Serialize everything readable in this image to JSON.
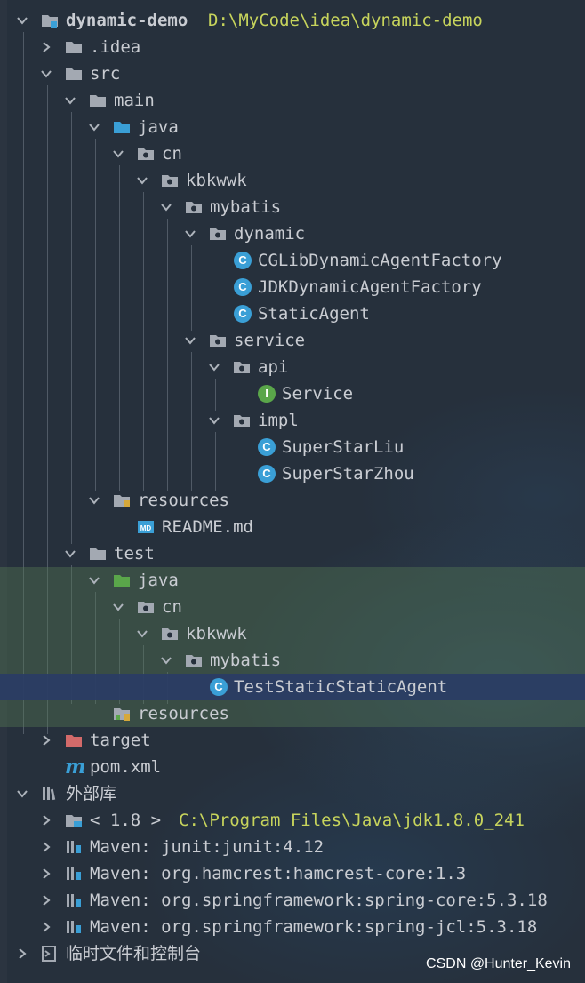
{
  "project": {
    "name": "dynamic-demo",
    "path": "D:\\MyCode\\idea\\dynamic-demo"
  },
  "nodes": {
    "idea": ".idea",
    "src": "src",
    "main": "main",
    "java_main": "java",
    "cn_main": "cn",
    "kbkwwk_main": "kbkwwk",
    "mybatis_main": "mybatis",
    "dynamic": "dynamic",
    "cglib": "CGLibDynamicAgentFactory",
    "jdk": "JDKDynamicAgentFactory",
    "static_agent": "StaticAgent",
    "service": "service",
    "api": "api",
    "service_intf": "Service",
    "impl": "impl",
    "liu": "SuperStarLiu",
    "zhou": "SuperStarZhou",
    "resources_main": "resources",
    "readme": "README.md",
    "test": "test",
    "java_test": "java",
    "cn_test": "cn",
    "kbkwwk_test": "kbkwwk",
    "mybatis_test": "mybatis",
    "test_class": "TestStaticStaticAgent",
    "resources_test": "resources",
    "target": "target",
    "pom": "pom.xml"
  },
  "external": {
    "label": "外部库",
    "jdk_label": "< 1.8 >",
    "jdk_path": "C:\\Program Files\\Java\\jdk1.8.0_241",
    "libs": [
      "Maven: junit:junit:4.12",
      "Maven: org.hamcrest:hamcrest-core:1.3",
      "Maven: org.springframework:spring-core:5.3.18",
      "Maven: org.springframework:spring-jcl:5.3.18"
    ]
  },
  "scratches": "临时文件和控制台",
  "watermark": "CSDN @Hunter_Kevin",
  "colors": {
    "background": "#26303c",
    "folder": "#a3a9b2",
    "source_folder": "#3a9fd6",
    "test_folder": "#5aa64a",
    "excluded_folder": "#d36a6a",
    "path_text": "#c7d45c",
    "highlight_green": "#4e684f",
    "highlight_blue": "#2b3e64"
  },
  "icons": [
    "chevron-down-icon",
    "chevron-right-icon",
    "module-icon",
    "folder-icon",
    "package-icon",
    "class-icon",
    "interface-icon",
    "markdown-icon",
    "maven-icon",
    "library-icon",
    "jdk-icon",
    "scratch-icon"
  ]
}
